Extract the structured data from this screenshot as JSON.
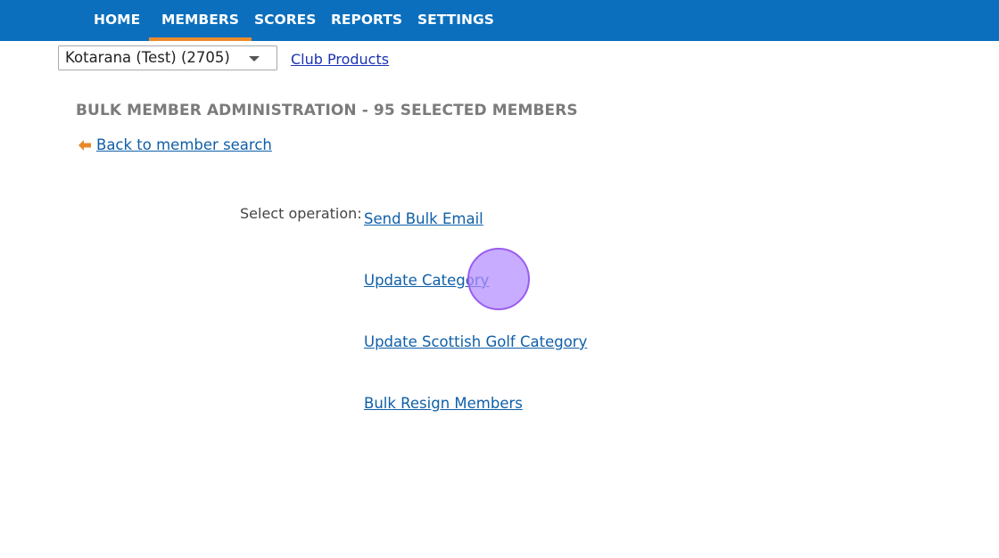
{
  "nav": {
    "items": [
      {
        "label": "HOME",
        "active": false
      },
      {
        "label": "MEMBERS",
        "active": true
      },
      {
        "label": "SCORES",
        "active": false
      },
      {
        "label": "REPORTS",
        "active": false
      },
      {
        "label": "SETTINGS",
        "active": false
      }
    ],
    "background_color": "#0b6fbd",
    "active_indicator_color": "#ec8b2e"
  },
  "club_selector": {
    "selected_value": "Kotarana (Test) (2705)",
    "icon": "chevron-down-icon"
  },
  "club_products_link": "Club Products",
  "page": {
    "title": "BULK MEMBER ADMINISTRATION - 95 SELECTED MEMBERS",
    "back_link": "Back to member search",
    "back_icon": "arrow-left-icon",
    "back_icon_color": "#e8892a"
  },
  "operations": {
    "label": "Select operation:",
    "items": [
      {
        "label": "Send Bulk Email"
      },
      {
        "label": "Update Category"
      },
      {
        "label": "Update Scottish Golf Category"
      },
      {
        "label": "Bulk Resign Members"
      }
    ]
  },
  "colors": {
    "link": "#0f5fa8",
    "title": "#7b7b7b",
    "cursor_highlight": "#b28cff"
  }
}
